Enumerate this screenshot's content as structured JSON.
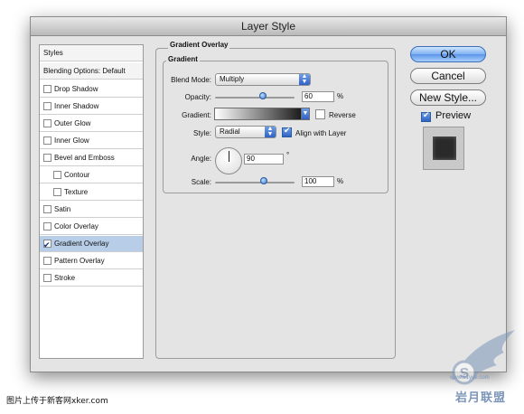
{
  "dialog": {
    "title": "Layer Style"
  },
  "styles_panel": {
    "header": "Styles",
    "blending": "Blending Options: Default",
    "items": [
      {
        "label": "Drop Shadow",
        "checked": false,
        "indent": false
      },
      {
        "label": "Inner Shadow",
        "checked": false,
        "indent": false
      },
      {
        "label": "Outer Glow",
        "checked": false,
        "indent": false
      },
      {
        "label": "Inner Glow",
        "checked": false,
        "indent": false
      },
      {
        "label": "Bevel and Emboss",
        "checked": false,
        "indent": false
      },
      {
        "label": "Contour",
        "checked": false,
        "indent": true
      },
      {
        "label": "Texture",
        "checked": false,
        "indent": true
      },
      {
        "label": "Satin",
        "checked": false,
        "indent": false
      },
      {
        "label": "Color Overlay",
        "checked": false,
        "indent": false
      },
      {
        "label": "Gradient Overlay",
        "checked": true,
        "indent": false,
        "selected": true
      },
      {
        "label": "Pattern Overlay",
        "checked": false,
        "indent": false
      },
      {
        "label": "Stroke",
        "checked": false,
        "indent": false
      }
    ]
  },
  "gradient_overlay": {
    "title": "Gradient Overlay",
    "subtitle": "Gradient",
    "blend_mode_label": "Blend Mode:",
    "blend_mode_value": "Multiply",
    "opacity_label": "Opacity:",
    "opacity_value": "60",
    "opacity_level": 0.6,
    "percent": "%",
    "gradient_label": "Gradient:",
    "reverse_label": "Reverse",
    "style_label": "Style:",
    "style_value": "Radial",
    "align_label": "Align with Layer",
    "angle_label": "Angle:",
    "angle_value": "90",
    "degree": "°",
    "scale_label": "Scale:",
    "scale_value": "100",
    "scale_level": 0.6
  },
  "buttons": {
    "ok": "OK",
    "cancel": "Cancel",
    "new_style": "New Style...",
    "preview_label": "Preview"
  },
  "watermark": {
    "text": "岩月联盟",
    "small": "www.51yue.com"
  },
  "caption": "图片上传于新客网xker.com",
  "colors": {
    "accent": "#3a78d0",
    "selected_row": "#b7cde8",
    "dialog_bg": "#e4e4e4"
  }
}
